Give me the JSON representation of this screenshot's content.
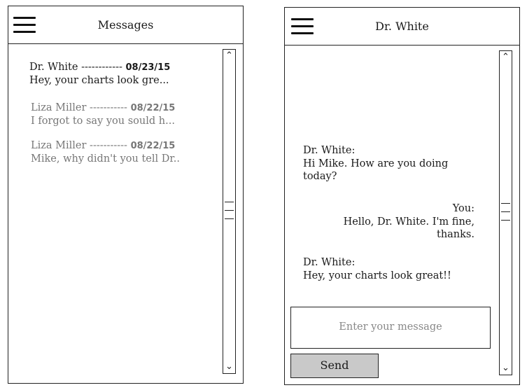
{
  "inbox": {
    "title": "Messages",
    "menu_icon": "hamburger-menu-icon",
    "messages": [
      {
        "sender": "Dr. White",
        "dashes": "------------",
        "date": "08/23/15",
        "preview": "Hey, your charts look gre...",
        "unread": true
      },
      {
        "sender": "Liza Miller",
        "dashes": "-----------",
        "date": "08/22/15",
        "preview": "I forgot to say you sould h...",
        "unread": false
      },
      {
        "sender": "Liza Miller",
        "dashes": "-----------",
        "date": "08/22/15",
        "preview": "Mike, why didn't you tell Dr..",
        "unread": false
      }
    ]
  },
  "chat": {
    "title": "Dr. White",
    "menu_icon": "hamburger-menu-icon",
    "messages": [
      {
        "from": "Dr. White:",
        "text": "Hi Mike. How are you doing today?",
        "align": "left"
      },
      {
        "from": "You:",
        "text": "Hello, Dr. White. I'm fine, thanks.",
        "align": "right"
      },
      {
        "from": "Dr. White:",
        "text": "Hey, your charts look great!!",
        "align": "left"
      }
    ],
    "input_placeholder": "Enter your message",
    "send_label": "Send"
  },
  "scrollbar": {
    "up_arrow": "^",
    "down_arrow": "v"
  }
}
